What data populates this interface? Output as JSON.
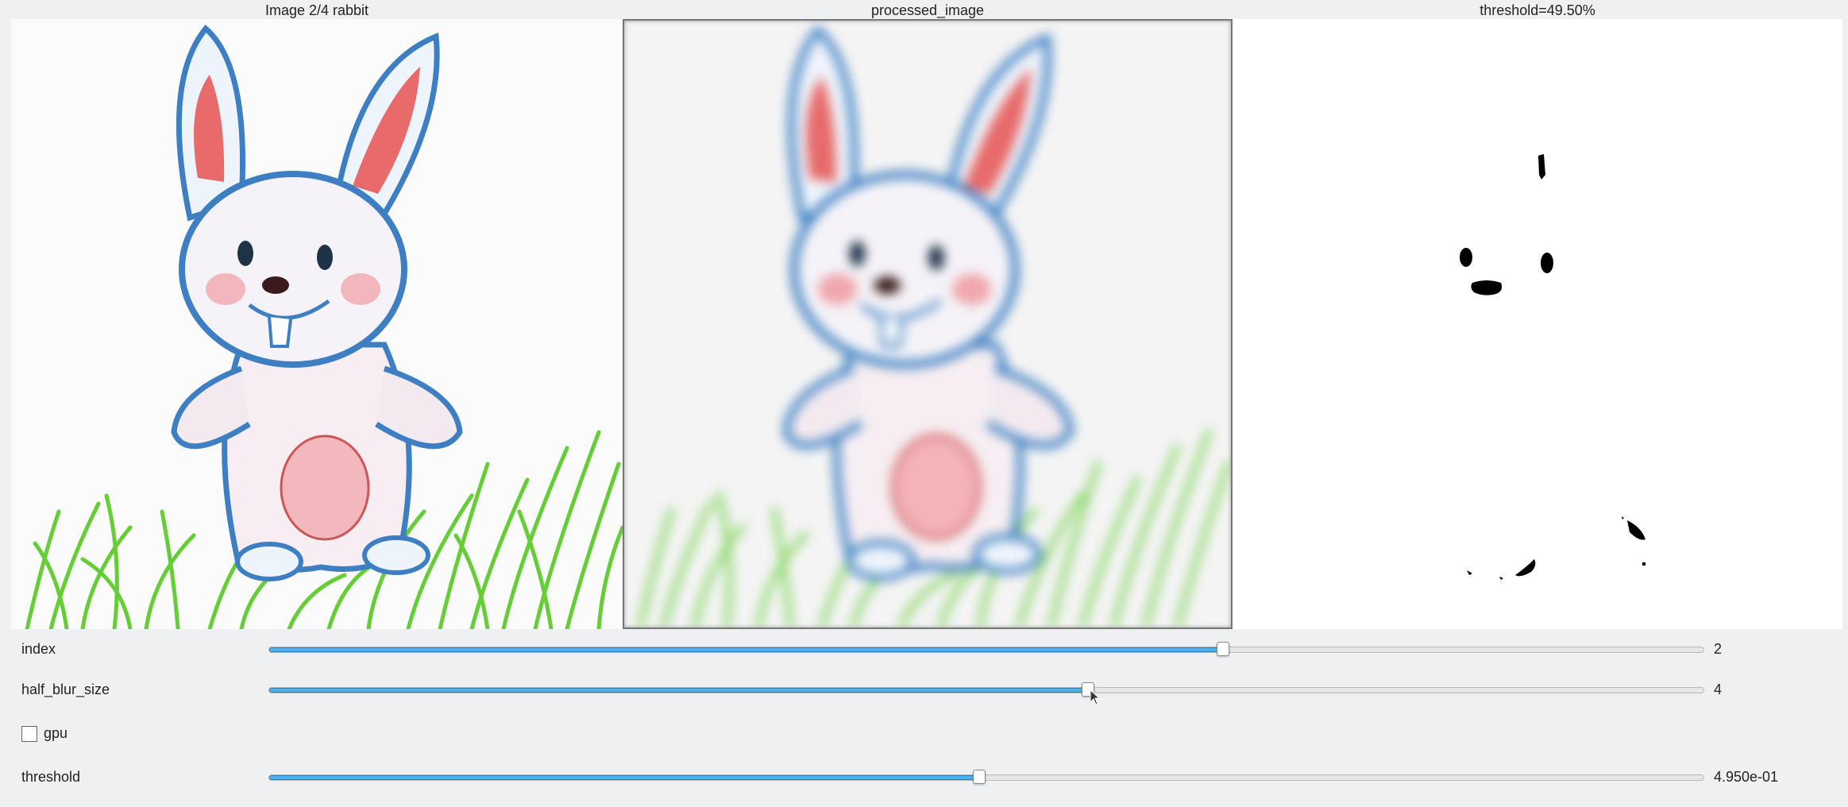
{
  "panels": [
    {
      "title": "Image 2/4 rabbit"
    },
    {
      "title": "processed_image"
    },
    {
      "title": "threshold=49.50%"
    }
  ],
  "controls": {
    "index": {
      "label": "index",
      "value_text": "2",
      "fraction": 0.665
    },
    "half_blur_size": {
      "label": "half_blur_size",
      "value_text": "4",
      "fraction": 0.571
    },
    "gpu": {
      "label": "gpu",
      "checked": false
    },
    "threshold": {
      "label": "threshold",
      "value_text": "4.950e-01",
      "fraction": 0.495
    }
  },
  "colors": {
    "slider_fill": "#4fb3ea",
    "outline_blue": "#3d7fc2",
    "ear_pink": "#e45a5a",
    "grass_green": "#55c921"
  },
  "icons": [
    "checkbox-icon",
    "mouse-cursor-icon"
  ]
}
